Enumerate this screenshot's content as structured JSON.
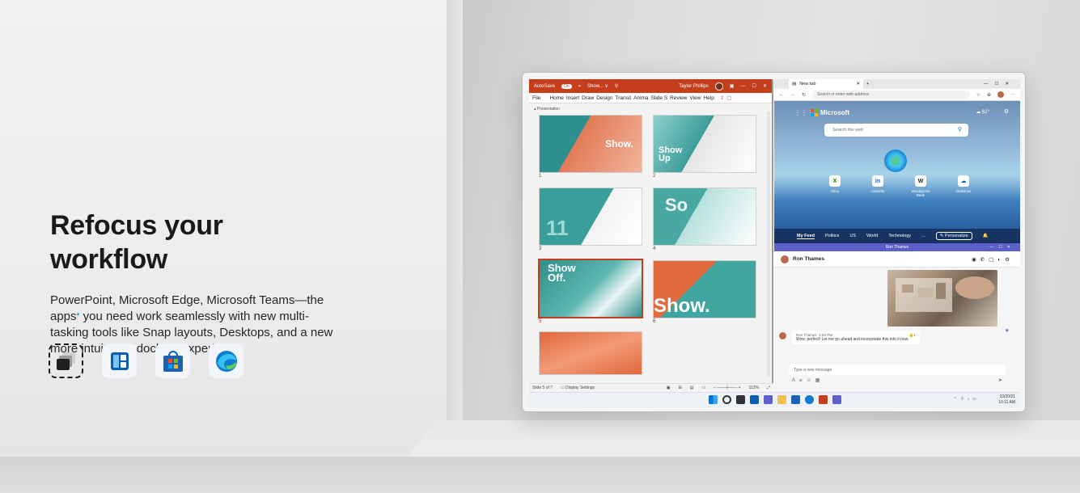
{
  "hero": {
    "headline": "Refocus your workflow",
    "body_part1": "PowerPoint, Microsoft Edge, Microsoft Teams—the apps",
    "footnote_marker": "*",
    "body_part2": " you need work seamlessly with new multi-tasking tools like Snap layouts, Desktops, and a new more intuitive redocking experience."
  },
  "app_icons": [
    "task-view-icon",
    "snap-layouts-icon",
    "microsoft-store-icon",
    "edge-icon"
  ],
  "powerpoint": {
    "autosave_label": "AutoSave",
    "autosave_state": "On",
    "doc_title": "Show... ∨",
    "user_name": "Taylor Phillips",
    "menu": [
      "File",
      "Home",
      "Insert",
      "Draw",
      "Design",
      "Transit",
      "Anima",
      "Slide S",
      "Review",
      "View",
      "Help"
    ],
    "pane_label": "Presentation",
    "slides": [
      {
        "num": "1",
        "text": "Show."
      },
      {
        "num": "2",
        "text": "Show Up"
      },
      {
        "num": "3",
        "text": "11"
      },
      {
        "num": "4",
        "text": "So"
      },
      {
        "num": "5",
        "text": "Show Off."
      },
      {
        "num": "6",
        "text": "Show."
      },
      {
        "num": "",
        "text": ""
      }
    ],
    "status_slide": "Slide 5 of 7",
    "status_display": "Display Settings",
    "zoom": "112%"
  },
  "edge": {
    "tab_label": "New tab",
    "address_placeholder": "Search or enter web address",
    "brand": "Microsoft",
    "weather": "62°",
    "search_placeholder": "Search the web",
    "quicklinks": [
      {
        "label": "Xbox",
        "glyph": "X"
      },
      {
        "label": "LinkedIn",
        "glyph": "in"
      },
      {
        "label": "Woodgrove Bank",
        "glyph": "W"
      },
      {
        "label": "OneDrive",
        "glyph": "☁"
      }
    ],
    "feed_tabs": [
      "My Feed",
      "Politics",
      "US",
      "World",
      "Technology",
      "..."
    ],
    "personalize_label": "Personalize"
  },
  "teams": {
    "window_title": "Ron Thames",
    "contact_name": "Ron Thames",
    "message_sender": "Ron Thames",
    "message_time": "1:54 PM",
    "message_text": "Wow, perfect! Let me go ahead and incorporate this into it now.",
    "reaction": "👍1",
    "compose_placeholder": "Type a new message"
  },
  "taskbar": {
    "date": "10/20/21",
    "time": "10:11 AM"
  },
  "colors": {
    "ppt_red": "#c43e1c",
    "teams_purple": "#5b5fc7",
    "edge_blue": "#0067b8"
  }
}
